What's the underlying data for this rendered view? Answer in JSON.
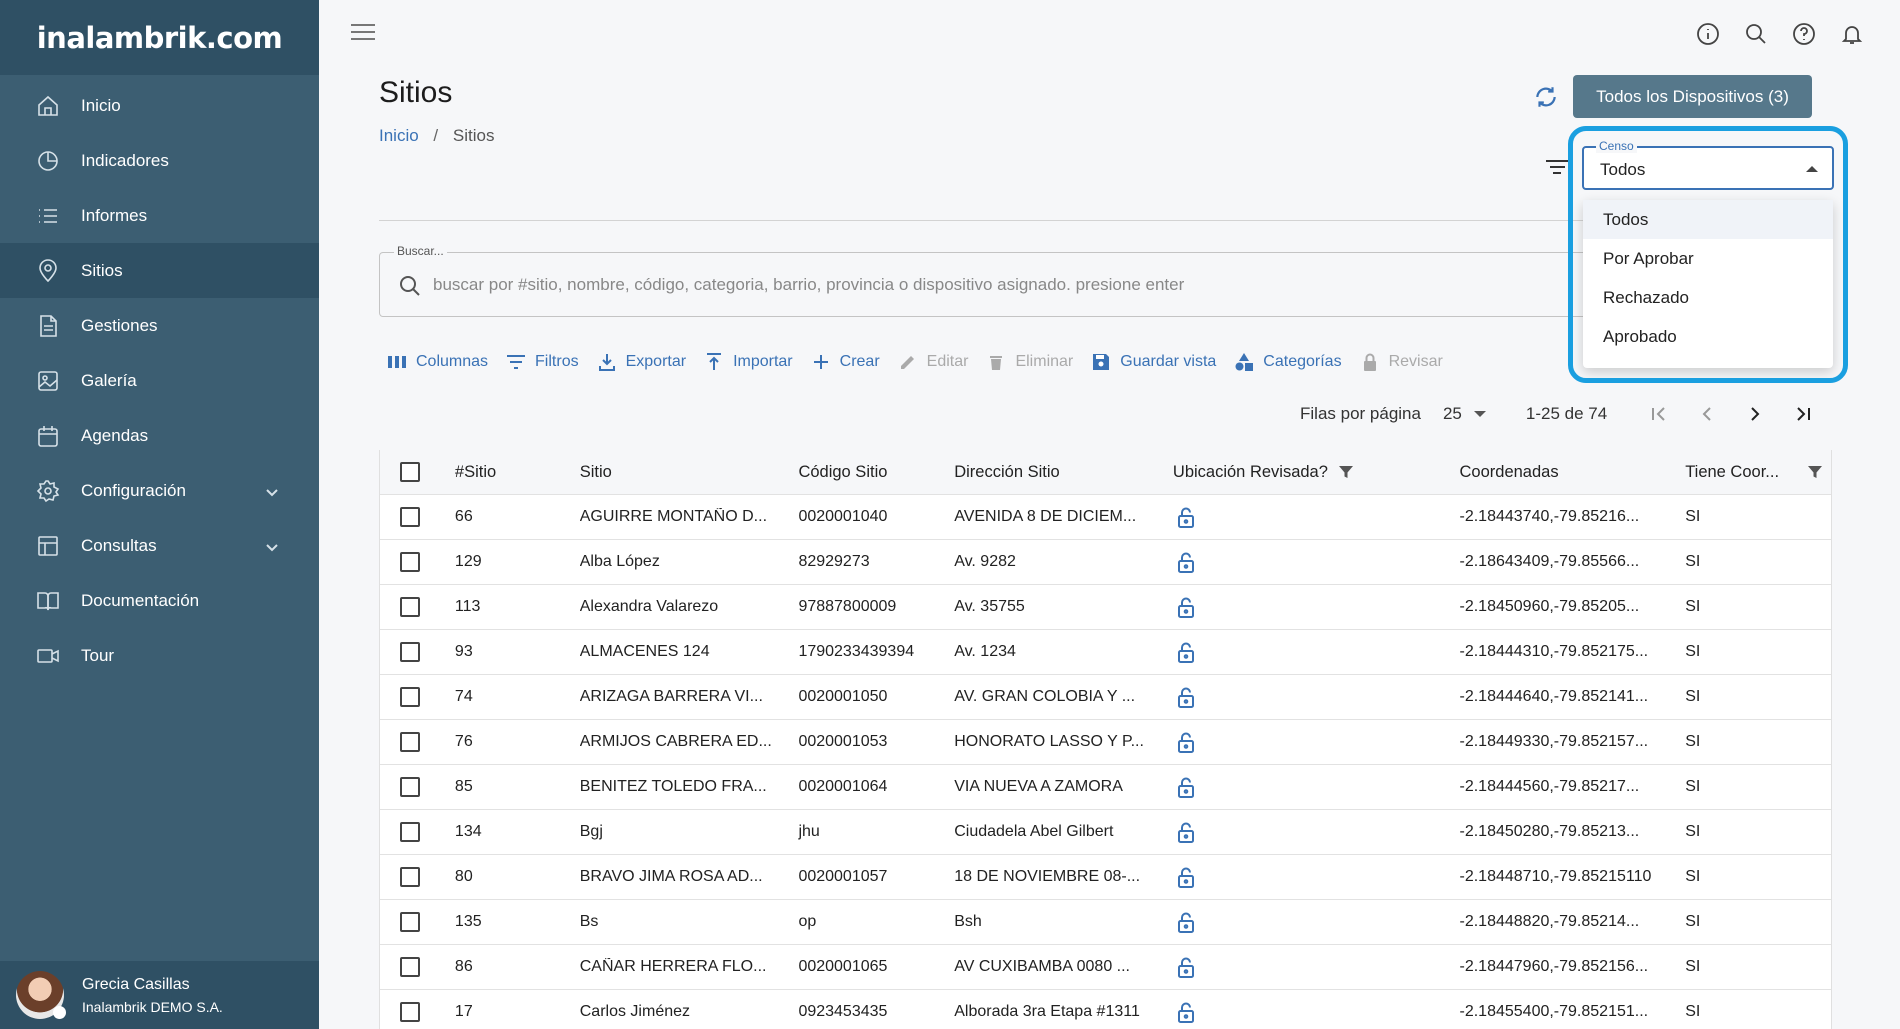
{
  "sidebar": {
    "logo": "inalambrik.com",
    "items": [
      {
        "label": "Inicio",
        "icon": "home-icon"
      },
      {
        "label": "Indicadores",
        "icon": "pie-chart-icon"
      },
      {
        "label": "Informes",
        "icon": "list-icon"
      },
      {
        "label": "Sitios",
        "icon": "location-pin-icon"
      },
      {
        "label": "Gestiones",
        "icon": "document-icon"
      },
      {
        "label": "Galería",
        "icon": "image-icon"
      },
      {
        "label": "Agendas",
        "icon": "calendar-icon"
      },
      {
        "label": "Configuración",
        "icon": "gear-icon"
      },
      {
        "label": "Consultas",
        "icon": "table-icon"
      },
      {
        "label": "Documentación",
        "icon": "book-icon"
      },
      {
        "label": "Tour",
        "icon": "video-icon"
      }
    ],
    "active_item": "Sitios",
    "user": {
      "name": "Grecia Casillas",
      "org": "Inalambrik DEMO S.A."
    }
  },
  "topbar": {
    "icons": [
      "info-icon",
      "search-icon",
      "help-icon",
      "bell-icon"
    ]
  },
  "page": {
    "title": "Sitios",
    "breadcrumb": {
      "home": "Inicio",
      "separator": "/",
      "current": "Sitios"
    },
    "devices_button": "Todos los Dispositivos (3)"
  },
  "search": {
    "label": "Buscar...",
    "placeholder": "buscar por #sitio, nombre, código, categoria, barrio, provincia o dispositivo asignado. presione enter",
    "value": ""
  },
  "toolbar": {
    "columnas": "Columnas",
    "filtros": "Filtros",
    "exportar": "Exportar",
    "importar": "Importar",
    "crear": "Crear",
    "editar": "Editar",
    "eliminar": "Eliminar",
    "guardar_vista": "Guardar vista",
    "categorias": "Categorías",
    "revisar": "Revisar"
  },
  "pager": {
    "rows_label": "Filas por página",
    "rows_value": "25",
    "range": "1-25 de 74"
  },
  "table": {
    "headers": {
      "num": "#Sitio",
      "sitio": "Sitio",
      "codigo": "Código Sitio",
      "direccion": "Dirección Sitio",
      "ubicacion": "Ubicación Revisada?",
      "coordenadas": "Coordenadas",
      "tiene": "Tiene Coor..."
    },
    "rows": [
      {
        "num": "66",
        "sitio": "AGUIRRE MONTAÑO D...",
        "codigo": "0020001040",
        "direccion": "AVENIDA 8 DE DICIEM...",
        "coord": "-2.18443740,-79.85216...",
        "tiene": "SI"
      },
      {
        "num": "129",
        "sitio": "Alba López",
        "codigo": "82929273",
        "direccion": "Av. 9282",
        "coord": "-2.18643409,-79.85566...",
        "tiene": "SI"
      },
      {
        "num": "113",
        "sitio": "Alexandra Valarezo",
        "codigo": "97887800009",
        "direccion": "Av. 35755",
        "coord": "-2.18450960,-79.85205...",
        "tiene": "SI"
      },
      {
        "num": "93",
        "sitio": "ALMACENES 124",
        "codigo": "1790233439394",
        "direccion": "Av. 1234",
        "coord": "-2.18444310,-79.852175...",
        "tiene": "SI"
      },
      {
        "num": "74",
        "sitio": "ARIZAGA BARRERA VI...",
        "codigo": "0020001050",
        "direccion": "AV. GRAN COLOBIA Y ...",
        "coord": "-2.18444640,-79.852141...",
        "tiene": "SI"
      },
      {
        "num": "76",
        "sitio": "ARMIJOS CABRERA ED...",
        "codigo": "0020001053",
        "direccion": "HONORATO LASSO Y P...",
        "coord": "-2.18449330,-79.852157...",
        "tiene": "SI"
      },
      {
        "num": "85",
        "sitio": "BENITEZ TOLEDO FRA...",
        "codigo": "0020001064",
        "direccion": "VIA NUEVA A ZAMORA",
        "coord": "-2.18444560,-79.85217...",
        "tiene": "SI"
      },
      {
        "num": "134",
        "sitio": "Bgj",
        "codigo": "jhu",
        "direccion": "Ciudadela Abel Gilbert",
        "coord": "-2.18450280,-79.85213...",
        "tiene": "SI"
      },
      {
        "num": "80",
        "sitio": "BRAVO JIMA ROSA AD...",
        "codigo": "0020001057",
        "direccion": "18 DE NOVIEMBRE 08-...",
        "coord": "-2.18448710,-79.85215110",
        "tiene": "SI"
      },
      {
        "num": "135",
        "sitio": "Bs",
        "codigo": "op",
        "direccion": "Bsh",
        "coord": "-2.18448820,-79.85214...",
        "tiene": "SI"
      },
      {
        "num": "86",
        "sitio": "CAÑAR HERRERA FLO...",
        "codigo": "0020001065",
        "direccion": "AV CUXIBAMBA 0080 ...",
        "coord": "-2.18447960,-79.852156...",
        "tiene": "SI"
      },
      {
        "num": "17",
        "sitio": "Carlos Jiménez",
        "codigo": "0923453435",
        "direccion": "Alborada 3ra Etapa #1311",
        "coord": "-2.18455400,-79.852151...",
        "tiene": "SI"
      }
    ]
  },
  "censo": {
    "label": "Censo",
    "value": "Todos",
    "options": [
      "Todos",
      "Por Aprobar",
      "Rechazado",
      "Aprobado"
    ],
    "highlight_color": "#1a9fe0"
  },
  "colors": {
    "sidebar": "#3c5e72",
    "sidebar_dark": "#2f5064",
    "accent": "#3a72b5",
    "button": "#56788b"
  }
}
